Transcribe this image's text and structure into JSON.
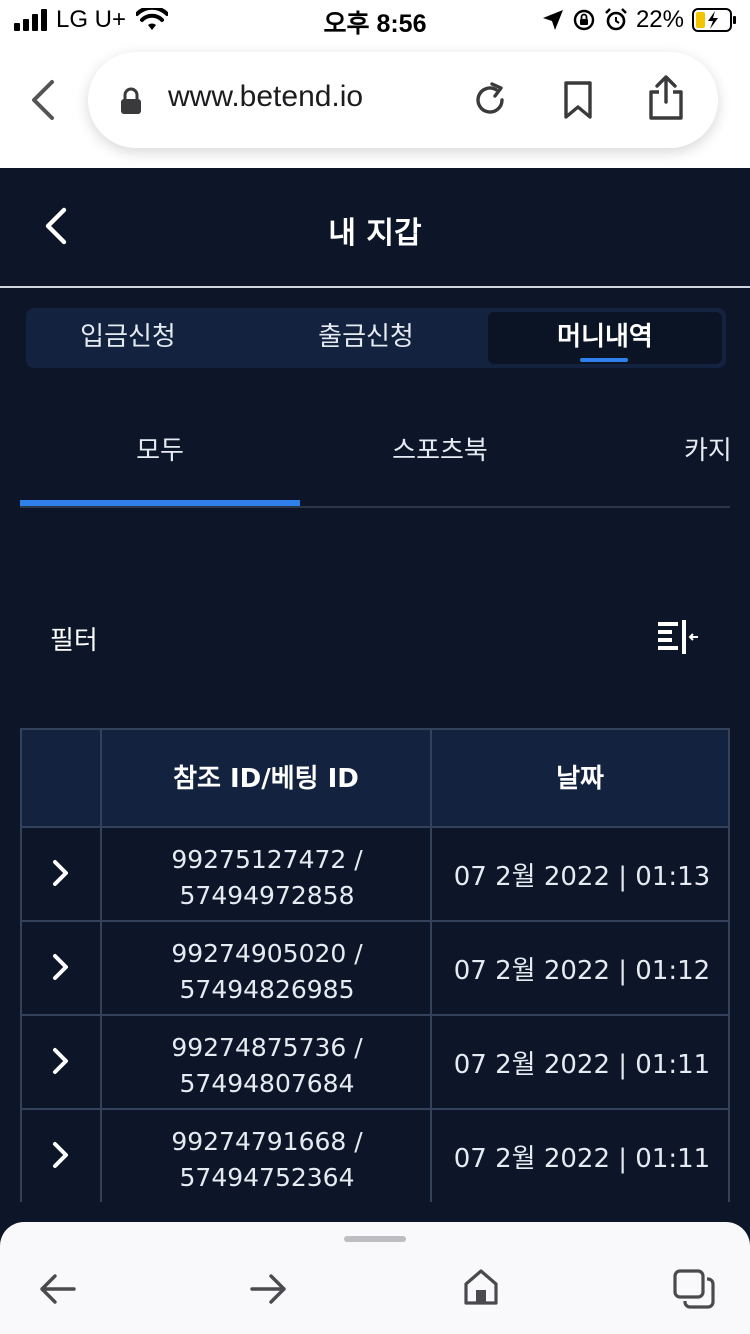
{
  "status_bar": {
    "carrier": "LG U+",
    "time": "오후 8:56",
    "battery": "22%"
  },
  "browser": {
    "url": "www.betend.io"
  },
  "header": {
    "title": "내 지갑"
  },
  "segment_tabs": [
    {
      "label": "입금신청",
      "active": false
    },
    {
      "label": "출금신청",
      "active": false
    },
    {
      "label": "머니내역",
      "active": true
    }
  ],
  "sub_tabs": [
    {
      "label": "모두",
      "active": true
    },
    {
      "label": "스포츠북",
      "active": false
    },
    {
      "label": "카지노",
      "active": false
    }
  ],
  "filter": {
    "label": "필터"
  },
  "table": {
    "headers": [
      "",
      "참조 ID/베팅 ID",
      "날짜"
    ],
    "rows": [
      {
        "ref_id": "99275127472 /",
        "bet_id": "57494972858",
        "date": "07 2월 2022 | 01:13"
      },
      {
        "ref_id": "99274905020 /",
        "bet_id": "57494826985",
        "date": "07 2월 2022 | 01:12"
      },
      {
        "ref_id": "99274875736 /",
        "bet_id": "57494807684",
        "date": "07 2월 2022 | 01:11"
      },
      {
        "ref_id": "99274791668 /",
        "bet_id": "57494752364",
        "date": "07 2월 2022 | 01:11"
      }
    ]
  },
  "colors": {
    "background": "#0c1628",
    "panel": "#13233f",
    "accent": "#2f80ed",
    "border": "#33415a"
  }
}
